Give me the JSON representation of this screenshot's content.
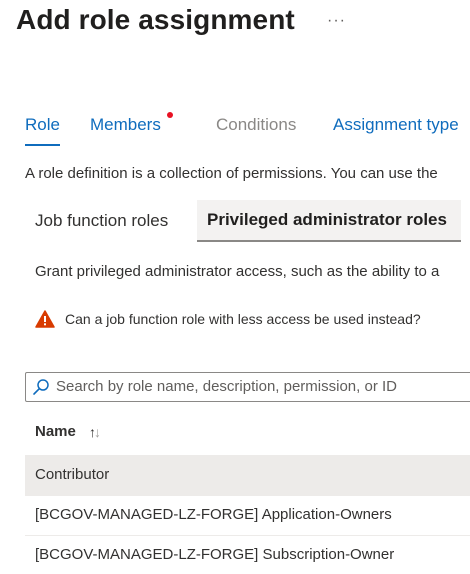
{
  "header": {
    "title": "Add role assignment",
    "more_label": "···"
  },
  "tabs": [
    {
      "label": "Role",
      "state": "active"
    },
    {
      "label": "Members",
      "state": "link",
      "has_error_dot": true
    },
    {
      "label": "Conditions",
      "state": "disabled"
    },
    {
      "label": "Assignment type",
      "state": "link"
    }
  ],
  "description": "A role definition is a collection of permissions. You can use the",
  "pivot": {
    "items": [
      {
        "label": "Job function roles",
        "selected": false
      },
      {
        "label": "Privileged administrator roles",
        "selected": true
      }
    ]
  },
  "grant_text": "Grant privileged administrator access, such as the ability to a",
  "warning": {
    "icon": "warning-icon",
    "text": "Can a job function role with less access be used instead?"
  },
  "search": {
    "icon": "search-icon",
    "placeholder": "Search by role name, description, permission, or ID",
    "value": ""
  },
  "table": {
    "column_header": "Name",
    "sort_indicator": "↑↓",
    "rows": [
      {
        "name": "Contributor",
        "selected": true
      },
      {
        "name": "[BCGOV-MANAGED-LZ-FORGE] Application-Owners",
        "selected": false
      },
      {
        "name": "[BCGOV-MANAGED-LZ-FORGE] Subscription-Owner",
        "selected": false
      }
    ]
  },
  "colors": {
    "accent": "#0f6cbd",
    "error_dot": "#e81123",
    "warning": "#d83b01"
  }
}
